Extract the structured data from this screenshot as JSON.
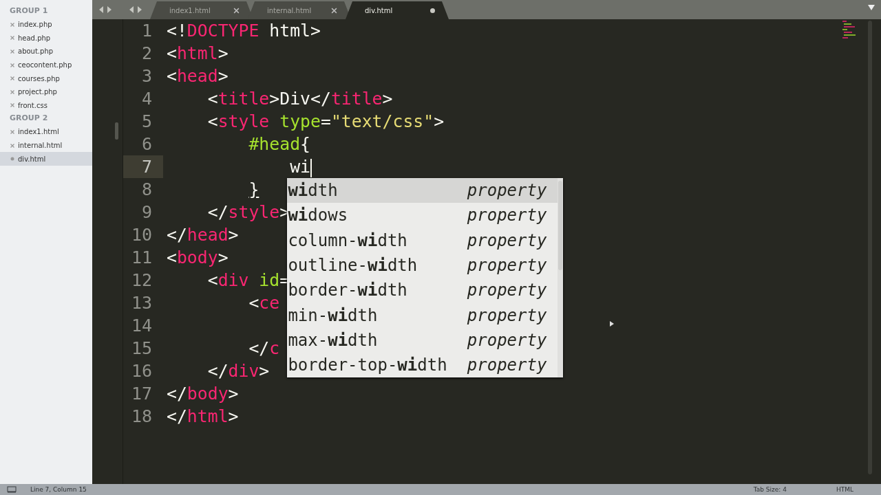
{
  "sidebar": {
    "groups": [
      {
        "title": "GROUP 1",
        "files": [
          {
            "name": "index.php",
            "selected": false,
            "dirty": false
          },
          {
            "name": "head.php",
            "selected": false,
            "dirty": false
          },
          {
            "name": "about.php",
            "selected": false,
            "dirty": false
          },
          {
            "name": "ceocontent.php",
            "selected": false,
            "dirty": false
          },
          {
            "name": "courses.php",
            "selected": false,
            "dirty": false
          },
          {
            "name": "project.php",
            "selected": false,
            "dirty": false
          },
          {
            "name": "front.css",
            "selected": false,
            "dirty": false
          }
        ]
      },
      {
        "title": "GROUP 2",
        "files": [
          {
            "name": "index1.html",
            "selected": false,
            "dirty": false
          },
          {
            "name": "internal.html",
            "selected": false,
            "dirty": false
          },
          {
            "name": "div.html",
            "selected": true,
            "dirty": true
          }
        ]
      }
    ]
  },
  "tabs": [
    {
      "label": "index1.html",
      "selected": false,
      "dirty": false
    },
    {
      "label": "internal.html",
      "selected": false,
      "dirty": false
    },
    {
      "label": "div.html",
      "selected": true,
      "dirty": true
    }
  ],
  "editor": {
    "lines": [
      {
        "number": "1",
        "current": false,
        "tokens": [
          {
            "kind": "punct",
            "text": "<!"
          },
          {
            "kind": "tag",
            "text": "DOCTYPE"
          },
          {
            "kind": "punct",
            "text": " html>"
          }
        ]
      },
      {
        "number": "2",
        "current": false,
        "tokens": [
          {
            "kind": "punct",
            "text": "<"
          },
          {
            "kind": "tag",
            "text": "html"
          },
          {
            "kind": "punct",
            "text": ">"
          }
        ]
      },
      {
        "number": "3",
        "current": false,
        "tokens": [
          {
            "kind": "punct",
            "text": "<"
          },
          {
            "kind": "tag",
            "text": "head"
          },
          {
            "kind": "punct",
            "text": ">"
          }
        ]
      },
      {
        "number": "4",
        "current": false,
        "tokens": [
          {
            "kind": "punct",
            "text": "    <"
          },
          {
            "kind": "tag",
            "text": "title"
          },
          {
            "kind": "punct",
            "text": ">Div</"
          },
          {
            "kind": "tag",
            "text": "title"
          },
          {
            "kind": "punct",
            "text": ">"
          }
        ]
      },
      {
        "number": "5",
        "current": false,
        "tokens": [
          {
            "kind": "punct",
            "text": "    <"
          },
          {
            "kind": "tag",
            "text": "style"
          },
          {
            "kind": "attr",
            "text": " type"
          },
          {
            "kind": "punct",
            "text": "="
          },
          {
            "kind": "string",
            "text": "\"text/css\""
          },
          {
            "kind": "punct",
            "text": ">"
          }
        ]
      },
      {
        "number": "6",
        "current": false,
        "tokens": [
          {
            "kind": "attr",
            "text": "        #head"
          },
          {
            "kind": "punct",
            "text": "{"
          }
        ]
      },
      {
        "number": "7",
        "current": true,
        "tokens": [
          {
            "kind": "punct",
            "text": "            wi"
          }
        ]
      },
      {
        "number": "8",
        "current": false,
        "tokens": [
          {
            "kind": "bracket",
            "text": "        }"
          }
        ]
      },
      {
        "number": "9",
        "current": false,
        "tokens": [
          {
            "kind": "punct",
            "text": "    </"
          },
          {
            "kind": "tag",
            "text": "style"
          },
          {
            "kind": "punct",
            "text": ">"
          }
        ]
      },
      {
        "number": "10",
        "current": false,
        "tokens": [
          {
            "kind": "punct",
            "text": "</"
          },
          {
            "kind": "tag",
            "text": "head"
          },
          {
            "kind": "punct",
            "text": ">"
          }
        ]
      },
      {
        "number": "11",
        "current": false,
        "tokens": [
          {
            "kind": "punct",
            "text": "<"
          },
          {
            "kind": "tag",
            "text": "body"
          },
          {
            "kind": "punct",
            "text": ">"
          }
        ]
      },
      {
        "number": "12",
        "current": false,
        "tokens": [
          {
            "kind": "punct",
            "text": "    <"
          },
          {
            "kind": "tag",
            "text": "div"
          },
          {
            "kind": "attr",
            "text": " id"
          },
          {
            "kind": "punct",
            "text": "="
          }
        ]
      },
      {
        "number": "13",
        "current": false,
        "tokens": [
          {
            "kind": "punct",
            "text": "        <"
          },
          {
            "kind": "tag",
            "text": "ce"
          }
        ]
      },
      {
        "number": "14",
        "current": false
      },
      {
        "number": "15",
        "current": false,
        "tokens": [
          {
            "kind": "punct",
            "text": "        </"
          },
          {
            "kind": "tag",
            "text": "c"
          }
        ]
      },
      {
        "number": "16",
        "current": false,
        "tokens": [
          {
            "kind": "punct",
            "text": "    </"
          },
          {
            "kind": "tag",
            "text": "div"
          },
          {
            "kind": "punct",
            "text": ">"
          }
        ]
      },
      {
        "number": "17",
        "current": false,
        "tokens": [
          {
            "kind": "punct",
            "text": "</"
          },
          {
            "kind": "tag",
            "text": "body"
          },
          {
            "kind": "punct",
            "text": ">"
          }
        ]
      },
      {
        "number": "18",
        "current": false,
        "tokens": [
          {
            "kind": "punct",
            "text": "</"
          },
          {
            "kind": "tag",
            "text": "html"
          },
          {
            "kind": "punct",
            "text": ">"
          }
        ]
      }
    ]
  },
  "autocomplete": {
    "items": [
      {
        "label": "**wi**dth",
        "type": "property",
        "selected": true
      },
      {
        "label": "**wi**dows",
        "type": "property",
        "selected": false
      },
      {
        "label": "column-**wi**dth",
        "type": "property",
        "selected": false
      },
      {
        "label": "outline-**wi**dth",
        "type": "property",
        "selected": false
      },
      {
        "label": "border-**wi**dth",
        "type": "property",
        "selected": false
      },
      {
        "label": "min-**wi**dth",
        "type": "property",
        "selected": false
      },
      {
        "label": "max-**wi**dth",
        "type": "property",
        "selected": false
      },
      {
        "label": "border-top-**wi**dth",
        "type": "property",
        "selected": false
      }
    ]
  },
  "status_bar": {
    "position": "Line 7, Column 15",
    "tab_size": "Tab Size: 4",
    "syntax": "HTML"
  }
}
